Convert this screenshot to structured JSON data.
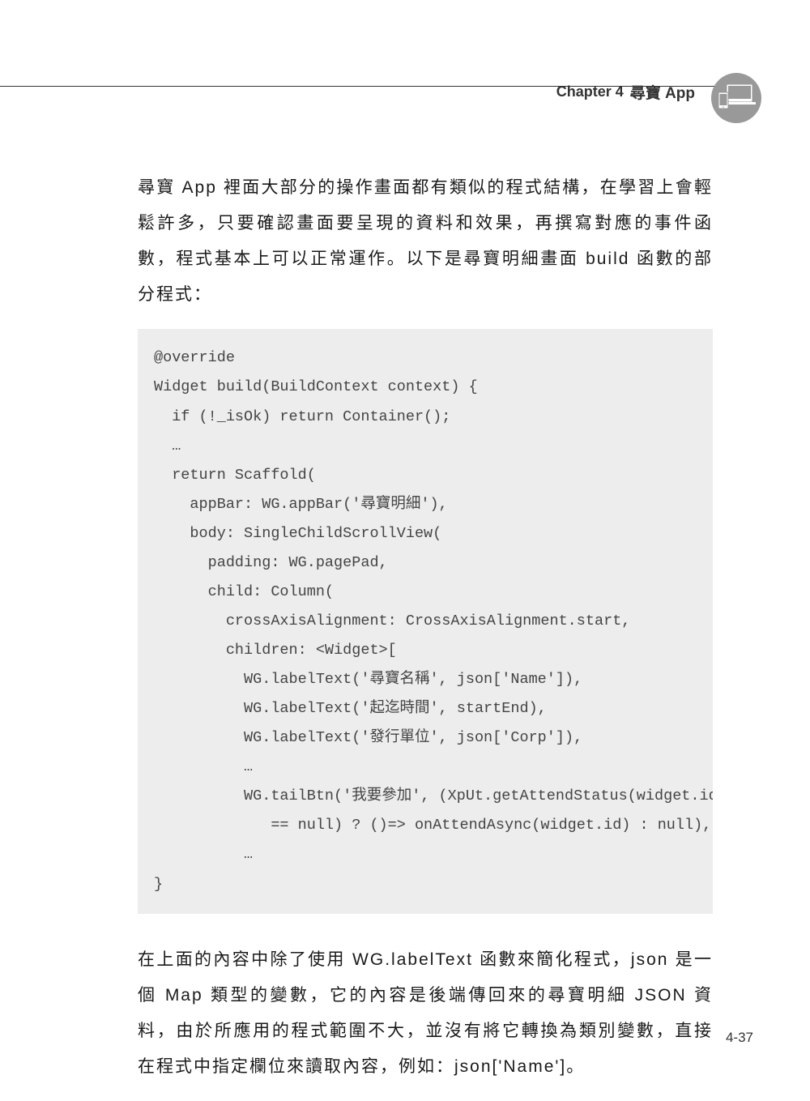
{
  "header": {
    "chapter_label": "Chapter",
    "chapter_number": "4",
    "chapter_title": "尋寶 App"
  },
  "paragraph1": "尋寶 App 裡面大部分的操作畫面都有類似的程式結構，在學習上會輕鬆許多，只要確認畫面要呈現的資料和效果，再撰寫對應的事件函數，程式基本上可以正常運作。以下是尋寶明細畫面 build 函數的部分程式：",
  "code": "@override\nWidget build(BuildContext context) {\n  if (!_isOk) return Container();\n  …\n  return Scaffold(\n    appBar: WG.appBar('尋寶明細'),\n    body: SingleChildScrollView(\n      padding: WG.pagePad,\n      child: Column(\n        crossAxisAlignment: CrossAxisAlignment.start,\n        children: <Widget>[\n          WG.labelText('尋寶名稱', json['Name']),\n          WG.labelText('起迄時間', startEnd),\n          WG.labelText('發行單位', json['Corp']),\n          …\n          WG.tailBtn('我要參加', (XpUt.getAttendStatus(widget.id)\n             == null) ? ()=> onAttendAsync(widget.id) : null),\n          …\n}",
  "paragraph2": "在上面的內容中除了使用 WG.labelText 函數來簡化程式，json 是一個 Map 類型的變數，它的內容是後端傳回來的尋寶明細 JSON 資料，由於所應用的程式範圍不大，並沒有將它轉換為類別變數，直接在程式中指定欄位來讀取內容，例如：json['Name']。",
  "page_number": "4-37"
}
